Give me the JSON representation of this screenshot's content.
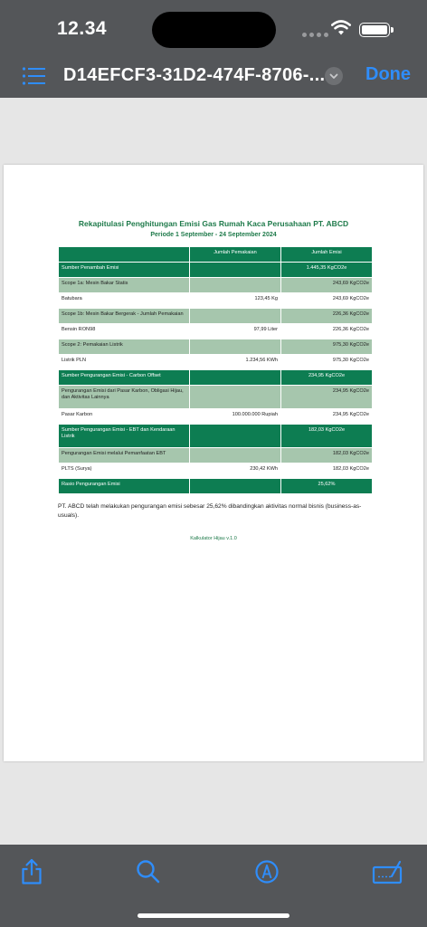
{
  "status": {
    "time": "12.34"
  },
  "navbar": {
    "title": "D14EFCF3-31D2-474F-8706-...",
    "done_label": "Done"
  },
  "report": {
    "title": "Rekapitulasi Penghitungan Emisi Gas Rumah Kaca Perusahaan PT. ABCD",
    "period": "Periode 1 September - 24 September 2024",
    "columns": [
      "",
      "Jumlah Pemakaian",
      "Jumlah Emisi"
    ],
    "rows": [
      [
        "Sumber Penambah Emisi",
        "",
        "1.445,35 KgCO2e"
      ],
      [
        "Scope 1a: Mesin Bakar Statis",
        "",
        "243,69 KgCO2e"
      ],
      [
        "Batubara",
        "123,45 Kg",
        "243,69 KgCO2e"
      ],
      [
        "Scope 1b: Mesin Bakar Bergerak - Jumlah Pemakaian",
        "",
        "226,36 KgCO2e"
      ],
      [
        "Bensin RON98",
        "97,99 Liter",
        "226,36 KgCO2e"
      ],
      [
        "Scope 2: Pemakaian Listrik",
        "",
        "975,30 KgCO2e"
      ],
      [
        "Listrik PLN",
        "1.234,56 KWh",
        "975,30 KgCO2e"
      ],
      [
        "Sumber Pengurangan Emisi - Carbon Offset",
        "",
        "234,95 KgCO2e"
      ],
      [
        "Pengurangan Emisi dari Pasar Karbon, Obligasi Hijau, dan Aktivitas Lainnya",
        "",
        "234,95 KgCO2e"
      ],
      [
        "Pasar Karbon",
        "100.000.000 Rupiah",
        "234,95 KgCO2e"
      ],
      [
        "Sumber Pengurangan Emisi - EBT dan Kendaraan Listrik",
        "",
        "182,03 KgCO2e"
      ],
      [
        "Pengurangan Emisi melalui Pemanfaatan EBT",
        "",
        "182,03 KgCO2e"
      ],
      [
        "PLTS (Surya)",
        "230,42 KWh",
        "182,03 KgCO2e"
      ],
      [
        "Rasio Pengurangan Emisi",
        "",
        "25,62%"
      ]
    ],
    "conclusion": "PT. ABCD telah melakukan pengurangan emisi sebesar 25,62% dibandingkan aktivitas normal bisnis (business-as-usuals).",
    "footer": "Kalkulator Hijau v.1.0"
  },
  "colors": {
    "header_green": "#0d7d52",
    "sub_green": "#a6c6ad",
    "accent_blue": "#2f8dfa",
    "title_green": "#1e7a4a"
  },
  "icons": [
    "list-icon",
    "chevron-down-icon",
    "share-icon",
    "search-icon",
    "markup-icon",
    "signature-icon"
  ]
}
